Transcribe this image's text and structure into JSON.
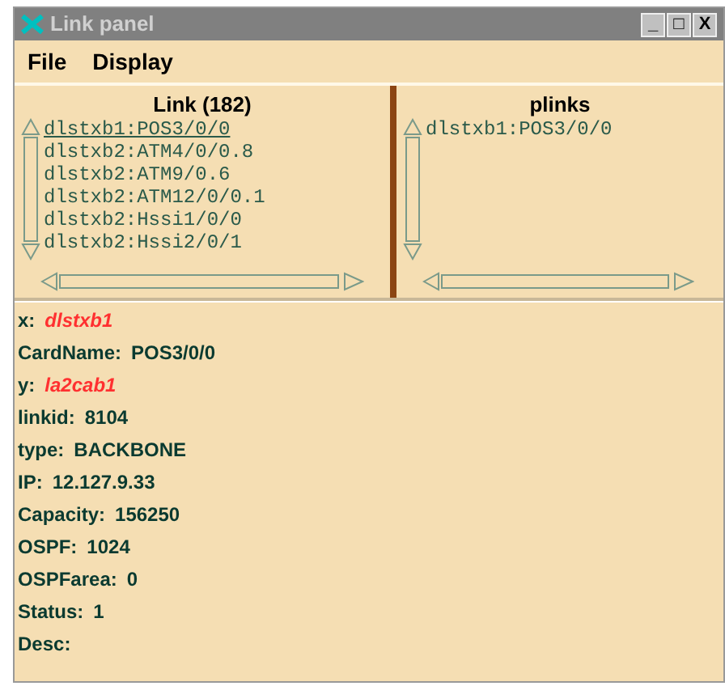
{
  "window": {
    "title": "Link panel",
    "controls": [
      "_",
      "□",
      "X"
    ]
  },
  "menu": [
    "File",
    "Display"
  ],
  "lists": [
    {
      "title": "Link (182)",
      "items": [
        {
          "label": "dlstxb1:POS3/0/0",
          "selected": true
        },
        {
          "label": "dlstxb2:ATM4/0/0.8",
          "selected": false
        },
        {
          "label": "dlstxb2:ATM9/0.6",
          "selected": false
        },
        {
          "label": "dlstxb2:ATM12/0/0.1",
          "selected": false
        },
        {
          "label": "dlstxb2:Hssi1/0/0",
          "selected": false
        },
        {
          "label": "dlstxb2:Hssi2/0/1",
          "selected": false
        }
      ]
    },
    {
      "title": "plinks",
      "items": [
        {
          "label": "dlstxb1:POS3/0/0",
          "selected": false
        }
      ]
    }
  ],
  "details": [
    {
      "label": "x:",
      "value": "dlstxb1",
      "highlight": true
    },
    {
      "label": "CardName:",
      "value": "POS3/0/0",
      "highlight": false
    },
    {
      "label": "y:",
      "value": "la2cab1",
      "highlight": true
    },
    {
      "label": "linkid:",
      "value": "8104",
      "highlight": false
    },
    {
      "label": "type:",
      "value": "BACKBONE",
      "highlight": false
    },
    {
      "label": "IP:",
      "value": "12.127.9.33",
      "highlight": false
    },
    {
      "label": "Capacity:",
      "value": "156250",
      "highlight": false
    },
    {
      "label": "OSPF:",
      "value": "1024",
      "highlight": false
    },
    {
      "label": "OSPFarea:",
      "value": "0",
      "highlight": false
    },
    {
      "label": "Status:",
      "value": "1",
      "highlight": false
    },
    {
      "label": "Desc:"
    }
  ]
}
